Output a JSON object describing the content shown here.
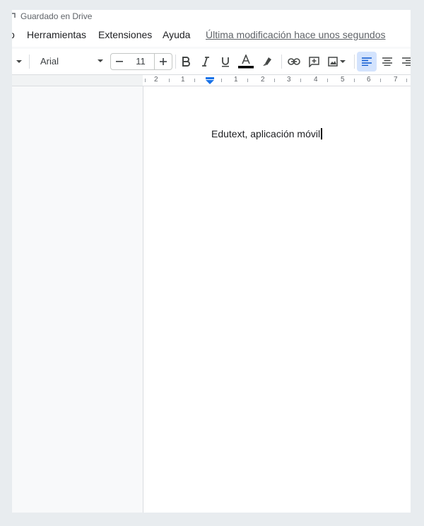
{
  "header": {
    "saved_status": "Guardado en Drive"
  },
  "menu": {
    "items": [
      "o",
      "Herramientas",
      "Extensiones",
      "Ayuda"
    ],
    "last_modified": "Última modificación hace unos segundos"
  },
  "toolbar": {
    "font": "Arial",
    "font_size": "11",
    "minus": "−",
    "plus": "+",
    "icons": [
      "bold-icon",
      "italic-icon",
      "underline-icon",
      "text-color-icon",
      "highlighter-icon",
      "link-icon",
      "comment-icon",
      "image-icon",
      "align-left-icon",
      "align-center-icon",
      "align-right-icon"
    ],
    "text_color": "#000000",
    "active_align": "left"
  },
  "ruler": {
    "numbers": [
      "2",
      "1",
      "1",
      "2",
      "3",
      "4",
      "5",
      "6",
      "7"
    ]
  },
  "document": {
    "text": "Edutext, aplicación móvil"
  },
  "colors": {
    "accent": "#1a73e8",
    "active_bg": "#d3e3fd",
    "workspace": "#f8f9fa"
  }
}
